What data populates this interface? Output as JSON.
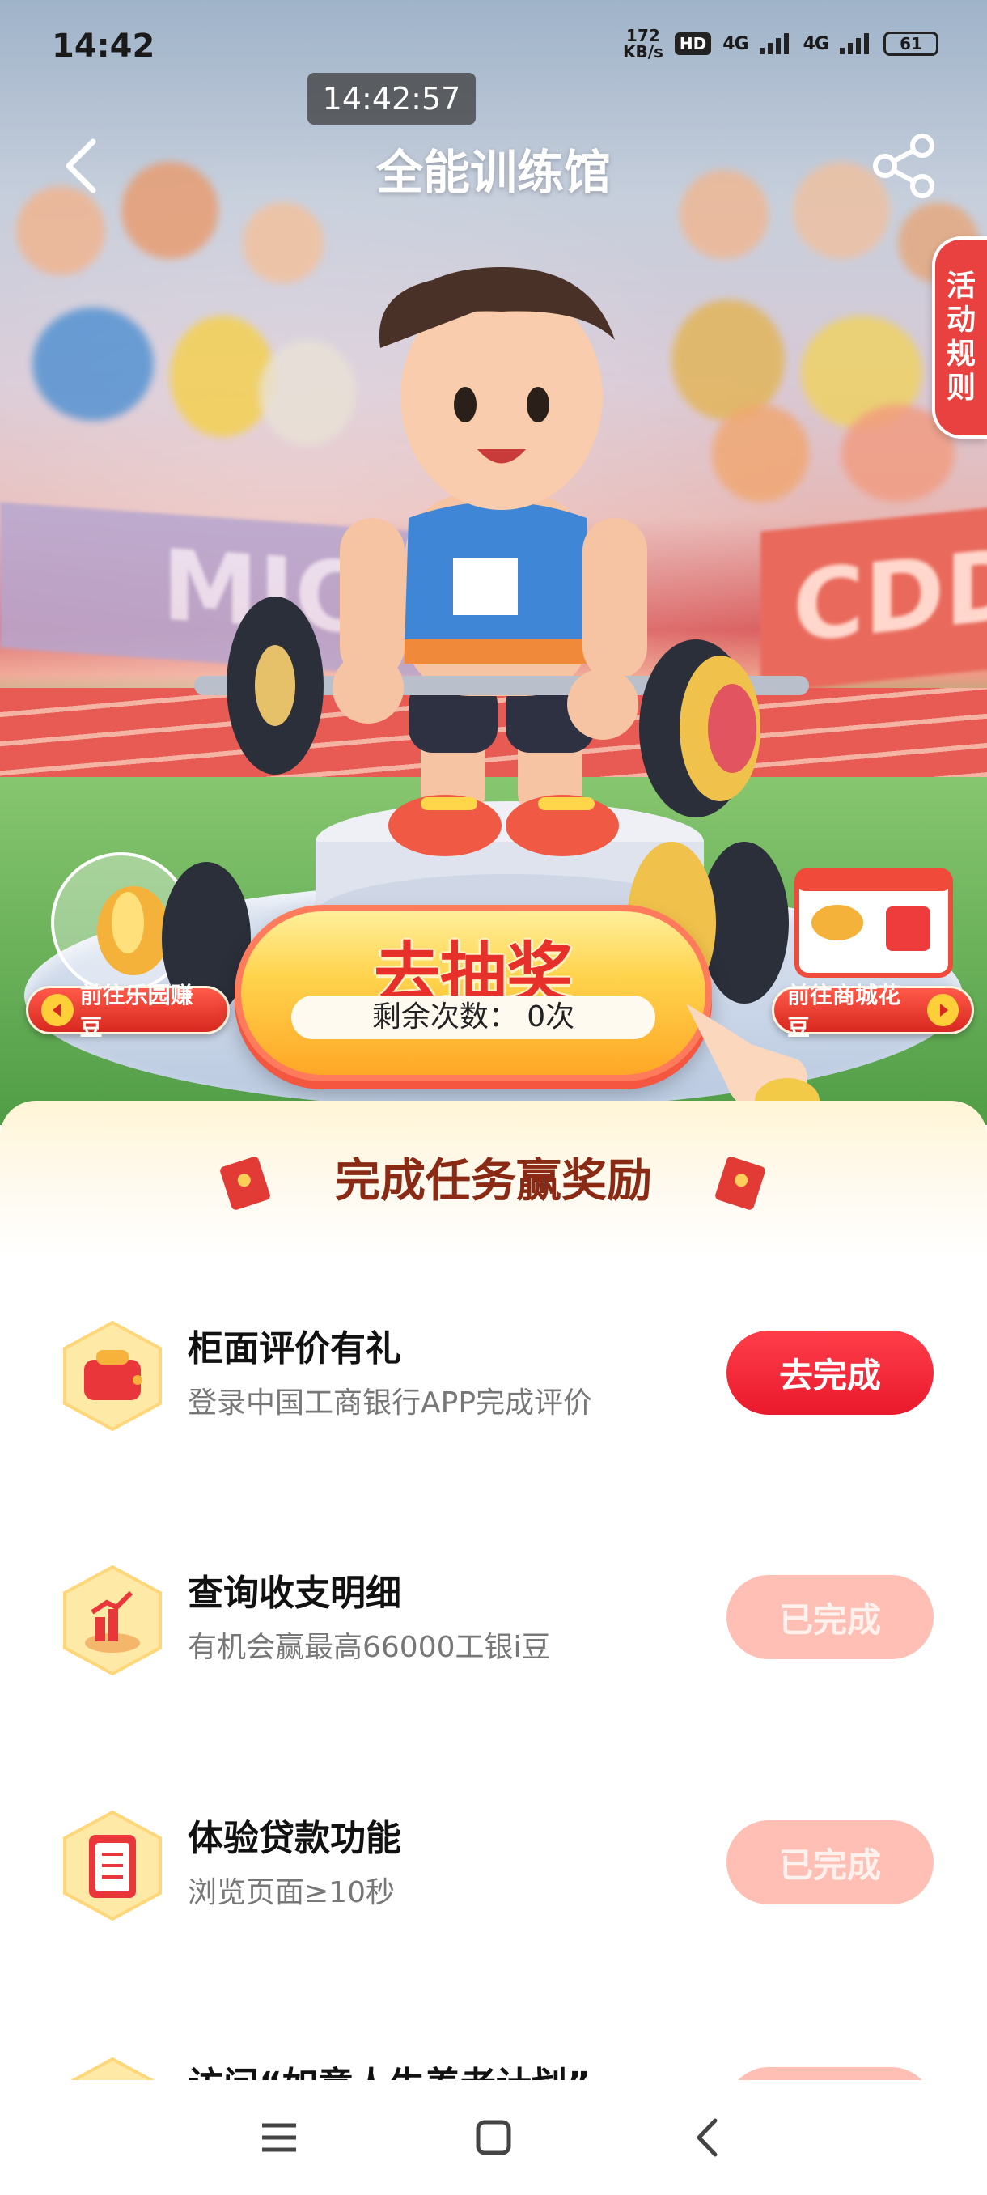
{
  "status_bar": {
    "time": "14:42",
    "net_speed_value": "172",
    "net_speed_unit": "KB/s",
    "hd_badge": "HD",
    "signal_1": "4G",
    "signal_2": "4G",
    "battery": "61"
  },
  "overlay_time": "14:42:57",
  "nav": {
    "title": "全能训练馆"
  },
  "hero": {
    "banner_left_text": "MICAC",
    "banner_right_text": "CDDI",
    "rules_tab": [
      "活",
      "动",
      "规",
      "则"
    ],
    "left_button": "前往乐园赚豆",
    "right_button": "前往商城花豆",
    "lottery": {
      "title": "去抽奖",
      "remaining_label": "剩余次数：",
      "remaining_value": "0次"
    }
  },
  "tasks_panel": {
    "title": "完成任务赢奖励",
    "items": [
      {
        "title": "柜面评价有礼",
        "desc": "登录中国工商银行APP完成评价",
        "button": "去完成",
        "status": "active"
      },
      {
        "title": "查询收支明细",
        "desc": "有机会赢最高66000工银i豆",
        "button": "已完成",
        "status": "done"
      },
      {
        "title": "体验贷款功能",
        "desc": "浏览页面≥10秒",
        "button": "已完成",
        "status": "done"
      },
      {
        "title": "访问“如意人生养老计划”",
        "desc": "",
        "button": "",
        "status": "done"
      }
    ]
  },
  "colors": {
    "primary_red": "#e9192c",
    "done_pink": "#ffbfb4",
    "title_brown": "#8a2a15",
    "lottery_yellow": "#ffd34d"
  }
}
